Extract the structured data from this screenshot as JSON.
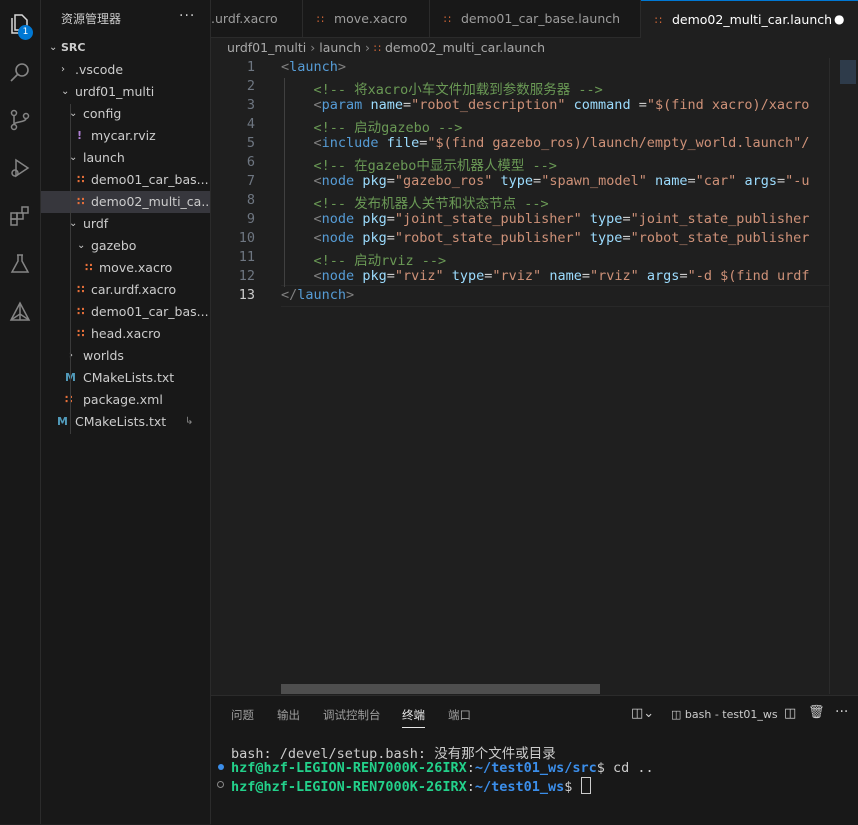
{
  "activity": {
    "explorer_badge": "1"
  },
  "sidebar": {
    "title": "资源管理器",
    "more": "···",
    "items": [
      {
        "label": "SRC",
        "chev": "⌄",
        "icon": ""
      },
      {
        "label": ".vscode",
        "chev": "›",
        "icon": ""
      },
      {
        "label": "urdf01_multi",
        "chev": "⌄",
        "icon": ""
      },
      {
        "label": "config",
        "chev": "⌄",
        "icon": ""
      },
      {
        "label": "mycar.rviz",
        "chev": "",
        "icon": "!"
      },
      {
        "label": "launch",
        "chev": "⌄",
        "icon": ""
      },
      {
        "label": "demo01_car_bas...",
        "chev": "",
        "icon": "rss"
      },
      {
        "label": "demo02_multi_ca...",
        "chev": "",
        "icon": "rss"
      },
      {
        "label": "urdf",
        "chev": "⌄",
        "icon": ""
      },
      {
        "label": "gazebo",
        "chev": "⌄",
        "icon": ""
      },
      {
        "label": "move.xacro",
        "chev": "",
        "icon": "rss"
      },
      {
        "label": "car.urdf.xacro",
        "chev": "",
        "icon": "rss"
      },
      {
        "label": "demo01_car_bas...",
        "chev": "",
        "icon": "rss"
      },
      {
        "label": "head.xacro",
        "chev": "",
        "icon": "rss"
      },
      {
        "label": "worlds",
        "chev": "›",
        "icon": ""
      },
      {
        "label": "CMakeLists.txt",
        "chev": "",
        "icon": "M"
      },
      {
        "label": "package.xml",
        "chev": "",
        "icon": "rss"
      },
      {
        "label": "CMakeLists.txt",
        "chev": "",
        "icon": "M"
      }
    ]
  },
  "tabs": [
    {
      "label": ".urdf.xacro"
    },
    {
      "label": "move.xacro"
    },
    {
      "label": "demo01_car_base.launch"
    },
    {
      "label": "demo02_multi_car.launch"
    }
  ],
  "breadcrumb": {
    "p1": "urdf01_multi",
    "p2": "launch",
    "p3": "demo02_multi_car.launch"
  },
  "editor": {
    "line_numbers": [
      "1",
      "2",
      "3",
      "4",
      "5",
      "6",
      "7",
      "8",
      "9",
      "10",
      "11",
      "12",
      "13"
    ],
    "lines": [
      "<launch>",
      "    <!-- 将xacro小车文件加载到参数服务器 -->",
      "    <param name=\"robot_description\" command =\"$(find xacro)/xacro",
      "    <!-- 启动gazebo -->",
      "    <include file=\"$(find gazebo_ros)/launch/empty_world.launch\"/",
      "    <!-- 在gazebo中显示机器人模型 -->",
      "    <node pkg=\"gazebo_ros\" type=\"spawn_model\" name=\"car\" args=\"-u",
      "    <!-- 发布机器人关节和状态节点 -->",
      "    <node pkg=\"joint_state_publisher\" type=\"joint_state_publisher",
      "    <node pkg=\"robot_state_publisher\" type=\"robot_state_publisher",
      "    <!-- 启动rviz -->",
      "    <node pkg=\"rviz\" type=\"rviz\" name=\"rviz\" args=\"-d $(find urdf",
      "</launch>"
    ]
  },
  "panel": {
    "tabs": [
      "问题",
      "输出",
      "调试控制台",
      "终端",
      "端口"
    ],
    "terminal_name": "bash - test01_ws",
    "terminal": {
      "line1": "bash: /devel/setup.bash: 没有那个文件或目录",
      "prompt_user": "hzf@hzf-LEGION-REN7000K-26IRX",
      "line2_path": "~/test01_ws/src",
      "line2_cmd": "$ cd ..",
      "line3_path": "~/test01_ws",
      "line3_cmd": "$ "
    }
  }
}
